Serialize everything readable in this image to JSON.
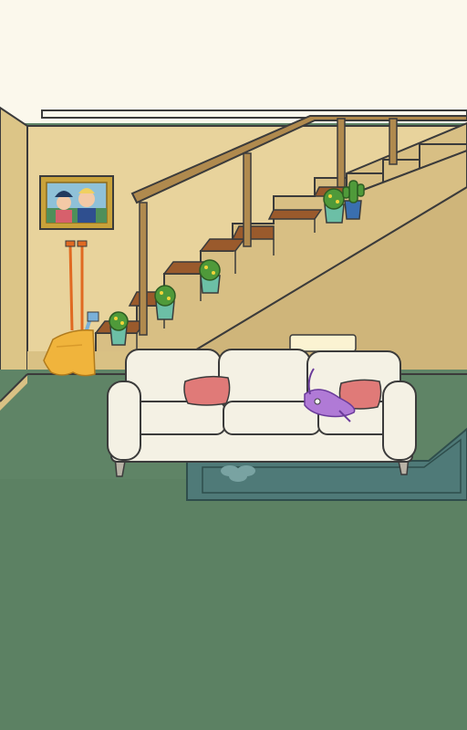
{
  "scene": {
    "name": "living-room-with-staircase",
    "colors": {
      "ceiling": "#fbf8ec",
      "wall": "#e8d39c",
      "wall_shadow": "#d9c184",
      "stair_side": "#d8bf84",
      "stair_tread": "#9a5a2c",
      "railing": "#b08a4e",
      "outline": "#3b3b3b",
      "floor": "#5f8466",
      "rug": "#4f7a78",
      "sofa": "#f4f1e4",
      "pillow": "#e07a78",
      "pot": "#6cbfa6",
      "plant": "#4f9a3a",
      "frame": "#c9a23a",
      "mop_yellow": "#f0b43c",
      "mop_handle": "#e06a22",
      "creature": "#b07ad6"
    },
    "objects": [
      {
        "id": "portrait",
        "icon": "family-portrait-icon"
      },
      {
        "id": "broom",
        "icon": "broom-icon"
      },
      {
        "id": "mop-with-rag",
        "icon": "mop-icon"
      },
      {
        "id": "plant-1",
        "icon": "potted-plant-icon"
      },
      {
        "id": "plant-2",
        "icon": "potted-plant-icon"
      },
      {
        "id": "plant-3",
        "icon": "potted-plant-icon"
      },
      {
        "id": "plant-4",
        "icon": "potted-plant-icon"
      },
      {
        "id": "cactus",
        "icon": "cactus-icon"
      },
      {
        "id": "sofa",
        "icon": "sofa-icon"
      },
      {
        "id": "pillow-left",
        "icon": "pillow-icon"
      },
      {
        "id": "pillow-right",
        "icon": "pillow-icon"
      },
      {
        "id": "purple-creature",
        "icon": "creature-icon"
      },
      {
        "id": "folded-blanket",
        "icon": "blanket-icon"
      },
      {
        "id": "rug",
        "icon": "rug-icon"
      }
    ]
  }
}
